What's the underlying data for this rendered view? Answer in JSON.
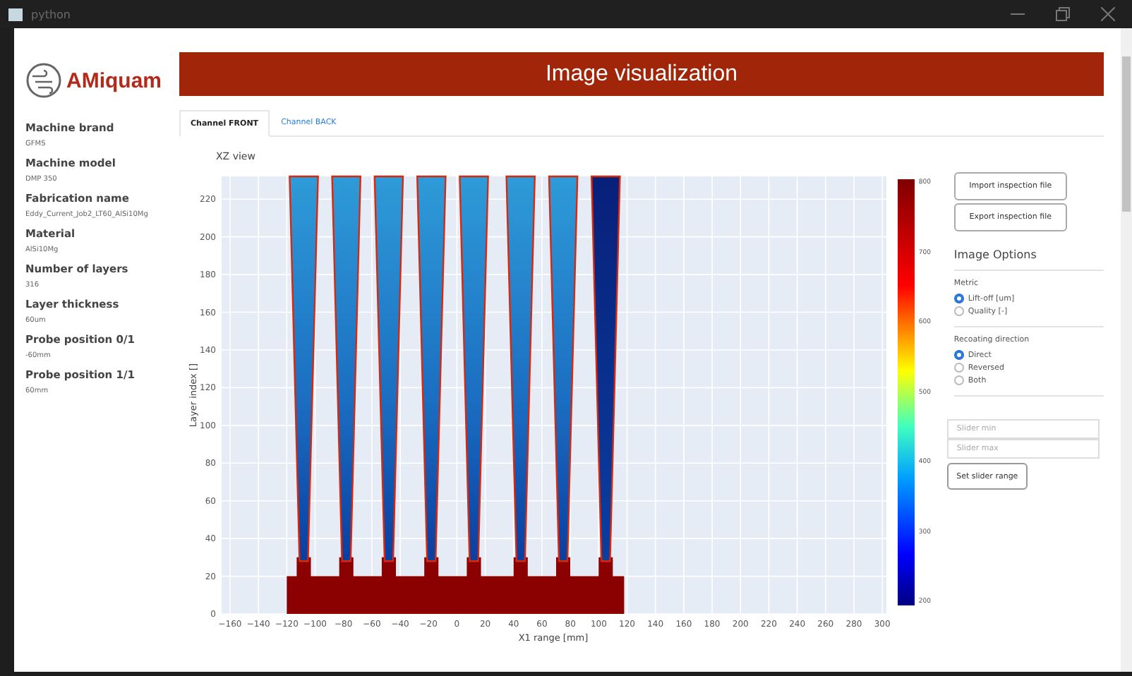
{
  "window": {
    "title": "python"
  },
  "logo": {
    "text": "AMiquam"
  },
  "sidebar": {
    "fields": [
      {
        "label": "Machine brand",
        "value": "GFMS"
      },
      {
        "label": "Machine model",
        "value": "DMP 350"
      },
      {
        "label": "Fabrication name",
        "value": "Eddy_Current_Job2_LT60_AlSi10Mg"
      },
      {
        "label": "Material",
        "value": "AlSi10Mg"
      },
      {
        "label": "Number of layers",
        "value": "316"
      },
      {
        "label": "Layer thickness",
        "value": "60um"
      },
      {
        "label": "Probe position 0/1",
        "value": "-60mm"
      },
      {
        "label": "Probe position 1/1",
        "value": "60mm"
      }
    ]
  },
  "header": {
    "title": "Image visualization"
  },
  "tabs": [
    {
      "label": "Channel FRONT",
      "selected": true
    },
    {
      "label": "Channel BACK",
      "selected": false
    }
  ],
  "plot": {
    "title": "XZ view",
    "xlabel": "X1 range [mm]",
    "ylabel": "Layer index []",
    "xticks": [
      "−160",
      "−140",
      "−120",
      "−100",
      "−80",
      "−60",
      "−40",
      "−20",
      "0",
      "20",
      "40",
      "60",
      "80",
      "100",
      "120",
      "140",
      "160",
      "180",
      "200",
      "220",
      "240",
      "260",
      "280",
      "300"
    ],
    "yticks": [
      "220",
      "200",
      "180",
      "160",
      "140",
      "120",
      "100",
      "80",
      "60",
      "40",
      "20",
      "0"
    ],
    "colorbar_ticks": [
      "800",
      "700",
      "600",
      "500",
      "400",
      "300",
      "200"
    ]
  },
  "actions": [
    "Import inspection file",
    "Export inspection file"
  ],
  "options": {
    "title": "Image Options",
    "groups": [
      {
        "label": "Metric",
        "options": [
          {
            "label": "Lift-off [um]",
            "selected": true
          },
          {
            "label": "Quality [-]",
            "selected": false
          }
        ]
      },
      {
        "label": "Recoating direction",
        "options": [
          {
            "label": "Direct",
            "selected": true
          },
          {
            "label": "Reversed",
            "selected": false
          },
          {
            "label": "Both",
            "selected": false
          }
        ]
      }
    ]
  },
  "slider": {
    "min_placeholder": "Slider min",
    "max_placeholder": "Slider max",
    "button": "Set slider range"
  }
}
